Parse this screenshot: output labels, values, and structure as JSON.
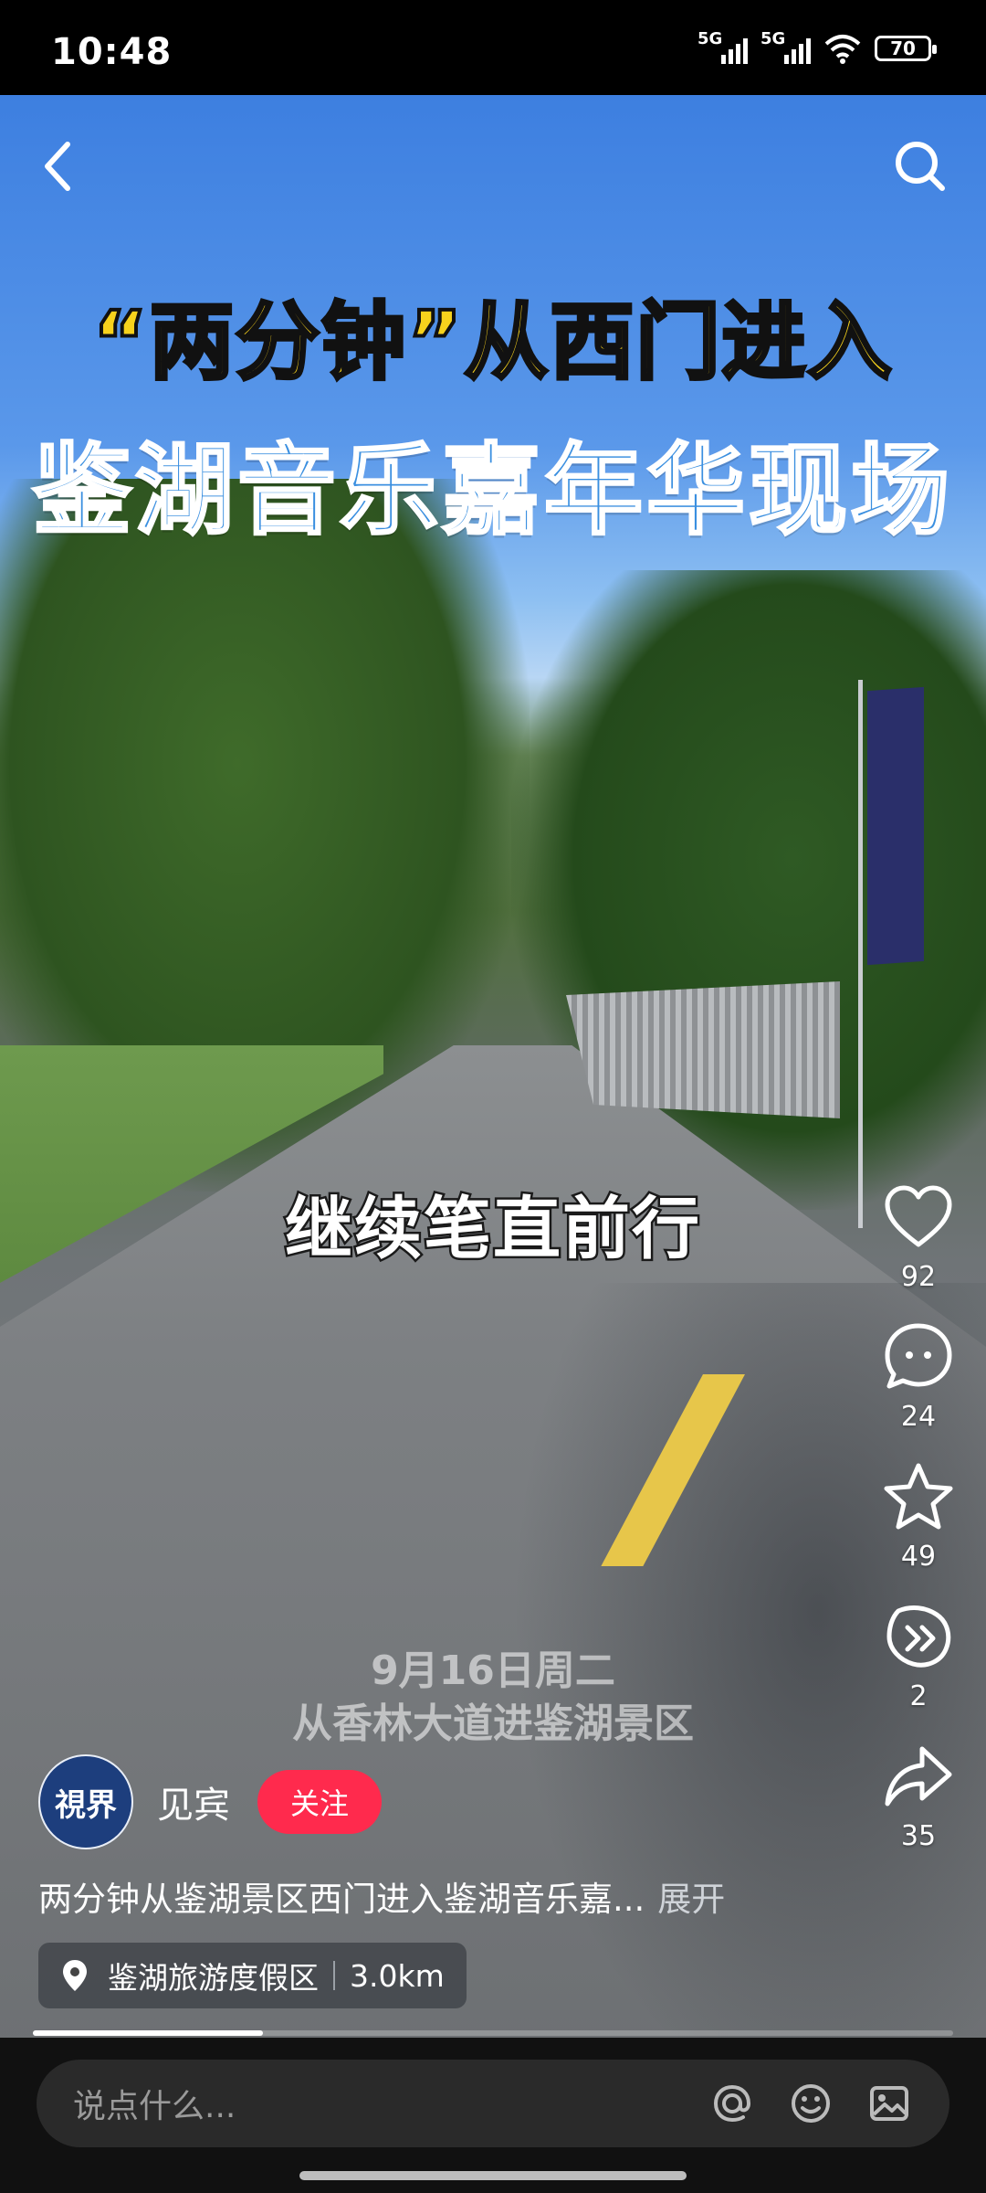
{
  "status_bar": {
    "time": "10:48",
    "net1": "5G",
    "net2": "5G",
    "battery": "70"
  },
  "video": {
    "headline_line1": "“两分钟”从西门进入",
    "headline_line2": "鉴湖音乐嘉年华现场",
    "subtitle": "继续笔直前行",
    "watermark_line1": "9月16日周二",
    "watermark_line2": "从香林大道进鉴湖景区"
  },
  "actions": {
    "like_count": "92",
    "comment_count": "24",
    "favorite_count": "49",
    "share_count": "2",
    "forward_count": "35"
  },
  "author": {
    "avatar_text": "視界",
    "name": "见宾",
    "follow_label": "关注"
  },
  "caption": {
    "text": "两分钟从鉴湖景区西门进入鉴湖音乐嘉...",
    "expand": "展开"
  },
  "location": {
    "name": "鉴湖旅游度假区",
    "distance": "3.0km"
  },
  "progress": {
    "fraction": 0.25
  },
  "comment_input": {
    "placeholder": "说点什么..."
  },
  "icons": [
    "back-icon",
    "search-icon",
    "heart-icon",
    "comment-icon",
    "star-icon",
    "share-icon",
    "forward-icon",
    "location-pin-icon",
    "at-icon",
    "emoji-icon",
    "image-icon"
  ]
}
